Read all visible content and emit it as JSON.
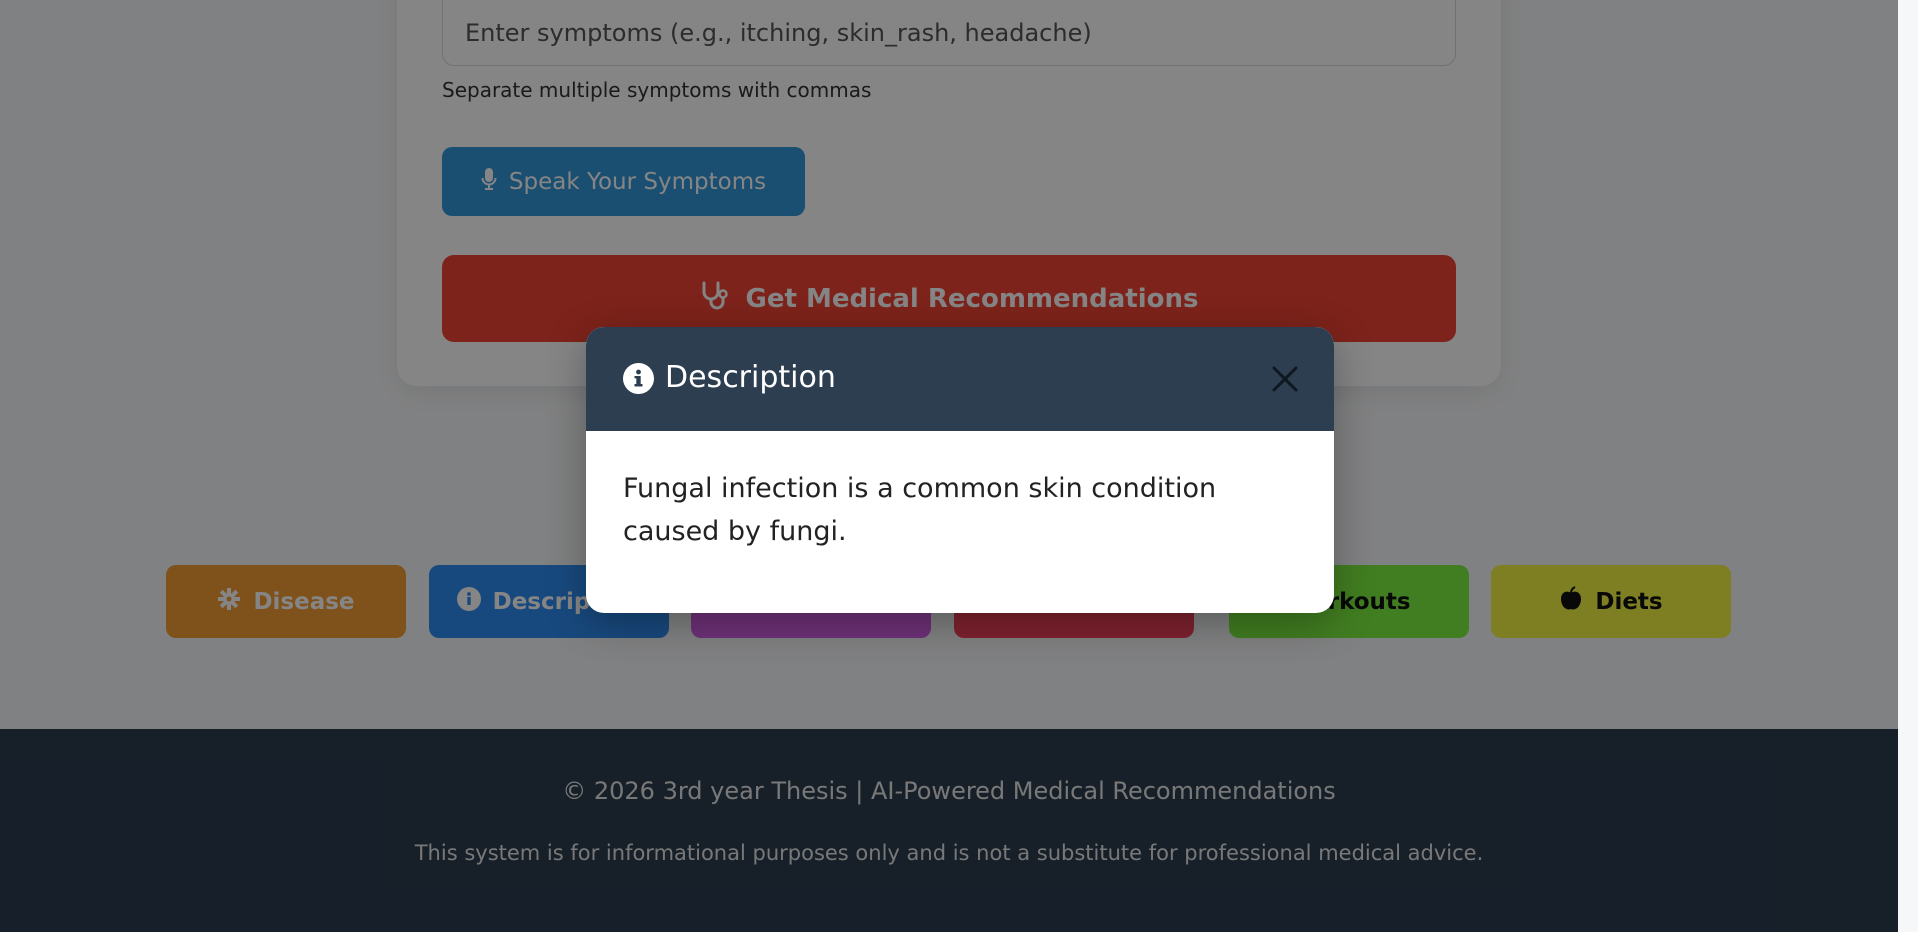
{
  "form": {
    "symptoms_placeholder": "Enter symptoms (e.g., itching, skin_rash, headache)",
    "symptoms_value": "",
    "hint": "Separate multiple symptoms with commas",
    "speak_label": "Speak Your Symptoms",
    "recommend_label": "Get Medical Recommendations"
  },
  "results": {
    "buttons": [
      {
        "label": "Disease",
        "icon": "gear-icon",
        "color": "#f39c34"
      },
      {
        "label": "Description",
        "icon": "info-circle-icon",
        "color": "#2f8cf2"
      },
      {
        "label": "",
        "icon": "",
        "color": "#d45ee6"
      },
      {
        "label": "",
        "icon": "",
        "color": "#f2415b"
      },
      {
        "label": "Workouts",
        "icon": "",
        "color": "#7df040"
      },
      {
        "label": "Diets",
        "icon": "apple-icon",
        "color": "#f1f244"
      }
    ]
  },
  "modal": {
    "title": "Description",
    "body": "Fungal infection is a common skin condition caused by fungi."
  },
  "footer": {
    "copyright": "© 2026 3rd year Thesis | AI-Powered Medical Recommendations",
    "disclaimer": "This system is for informational purposes only and is not a substitute for professional medical advice."
  },
  "colors": {
    "header": "#2c3e50",
    "overlay": "rgba(0,0,0,0.48)"
  }
}
